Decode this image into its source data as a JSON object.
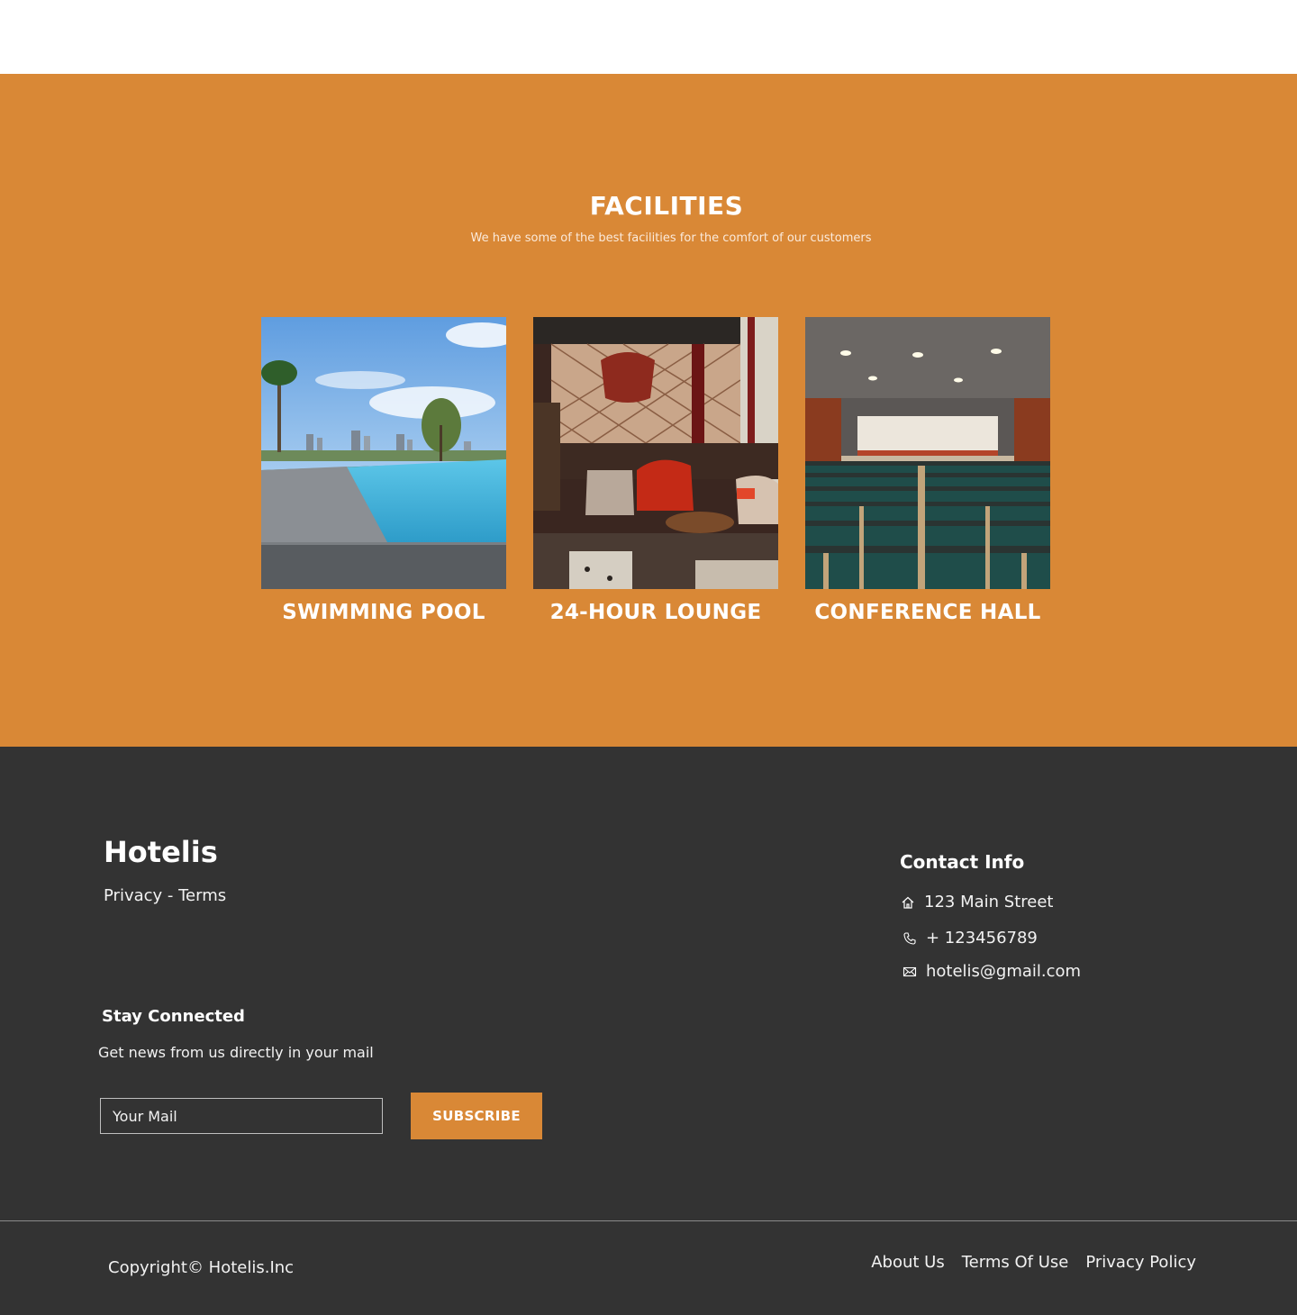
{
  "facilities": {
    "title": "FACILITIES",
    "subtitle": "We have some of the best facilities for the comfort of our customers",
    "accent_color": "#d98836",
    "cards": [
      {
        "label": "SWIMMING POOL",
        "image": "rooftop-infinity-pool-photo"
      },
      {
        "label": "24-HOUR LOUNGE",
        "image": "lounge-interior-photo"
      },
      {
        "label": "CONFERENCE HALL",
        "image": "conference-hall-seats-photo"
      }
    ]
  },
  "footer": {
    "background_color": "#333333",
    "brand": "Hotelis",
    "privacy_terms": "Privacy - Terms",
    "contact": {
      "title": "Contact Info",
      "address": "123 Main Street",
      "phone": "+ 123456789",
      "email": "hotelis@gmail.com",
      "icons": [
        "home-icon",
        "phone-icon",
        "mail-icon"
      ]
    },
    "newsletter": {
      "title": "Stay Connected",
      "subtitle": "Get news from us directly in your mail",
      "input_placeholder": "Your Mail",
      "button_label": "SUBSCRIBE"
    },
    "copyright": "Copyright© Hotelis.Inc",
    "links": [
      "About Us",
      "Terms Of Use",
      "Privacy Policy"
    ]
  }
}
